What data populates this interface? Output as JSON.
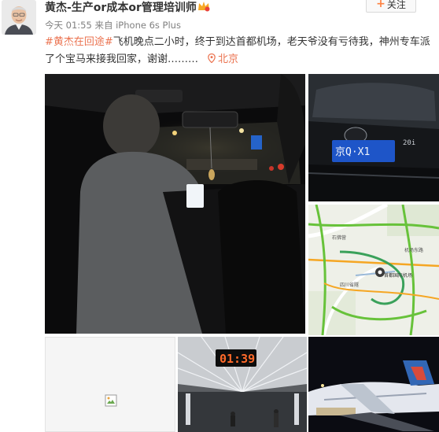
{
  "post": {
    "username": "黄杰-生产or成本or管理培训师",
    "follow_label": "关注",
    "time": "今天 01:55",
    "source_prefix": "来自",
    "device": "iPhone 6s Plus",
    "hashtag": "#黄杰在回途#",
    "text": "飞机晚点二小时，终于到达首都机场，老天爷没有亏待我，神州专车派了个宝马来接我回家，谢谢………",
    "location": "北京"
  },
  "images": {
    "car_plate": "京Q·X1",
    "car_badge": "20i",
    "arrival_clock": "01:39",
    "map_labels": [
      "首都国际机场",
      "四川省隧",
      "石佛营",
      "机场东路"
    ]
  },
  "colors": {
    "accent_orange": "#eb7350",
    "follow_plus": "#ff8140",
    "meta_gray": "#808080",
    "map_green": "#67c23a",
    "map_orange": "#f5a623"
  },
  "icons": {
    "vip": "vip-crown-icon",
    "location": "location-pin-icon",
    "broken_image": "broken-image-icon",
    "map_marker": "map-marker-icon"
  }
}
